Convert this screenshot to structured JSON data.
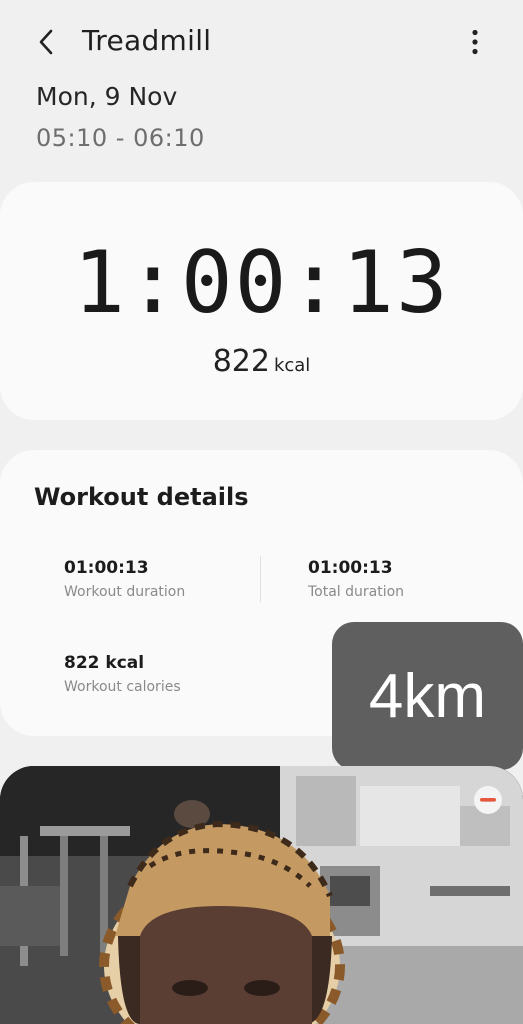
{
  "header": {
    "title": "Treadmill",
    "back_icon": "chevron-left-icon",
    "menu_icon": "more-vert-icon"
  },
  "session": {
    "date": "Mon, 9 Nov",
    "time_range": "05:10 - 06:10"
  },
  "summary": {
    "duration": "1:00:13",
    "calories_value": "822",
    "calories_unit": "kcal"
  },
  "details": {
    "title": "Workout details",
    "stats": [
      {
        "value": "01:00:13",
        "label": "Workout duration"
      },
      {
        "value": "01:00:13",
        "label": "Total duration"
      },
      {
        "value": "822 kcal",
        "label": "Workout calories"
      }
    ]
  },
  "overlay": {
    "distance": "4km"
  },
  "photo": {
    "remove_icon": "minus-circle-icon",
    "accent_color": "#e4583c"
  }
}
